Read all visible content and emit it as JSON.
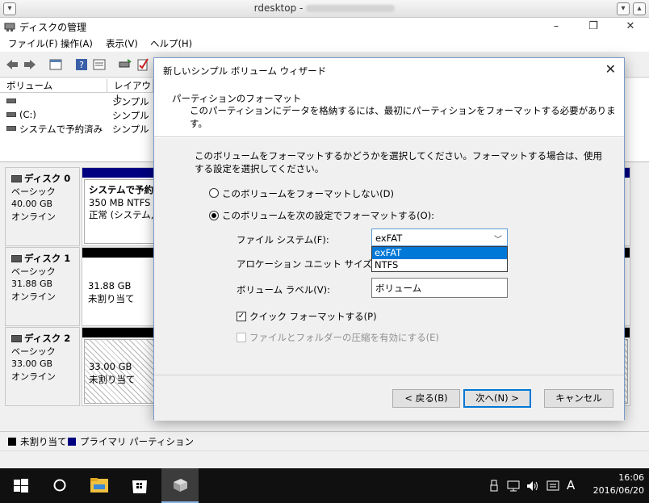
{
  "window": {
    "title": "rdesktop -",
    "app_title": "ディスクの管理",
    "minimize": "–",
    "restore": "❐",
    "close": "✕"
  },
  "menu": [
    "ファイル(F)",
    "操作(A)",
    "表示(V)",
    "ヘルプ(H)"
  ],
  "volume_list": {
    "columns": [
      "ボリューム",
      "レイアウト"
    ],
    "rows": [
      {
        "name": "",
        "layout": "シンプル"
      },
      {
        "name": "(C:)",
        "layout": "シンプル"
      },
      {
        "name": "システムで予約済み",
        "layout": "シンプル"
      }
    ]
  },
  "disks": [
    {
      "name": "ディスク 0",
      "type": "ベーシック",
      "size": "40.00 GB",
      "status": "オンライン",
      "partition": {
        "line1": "システムで予約済",
        "line2": "350 MB NTFS",
        "line3": "正常 (システム, ア"
      }
    },
    {
      "name": "ディスク 1",
      "type": "ベーシック",
      "size": "31.88 GB",
      "status": "オンライン",
      "partition": {
        "line1": "31.88 GB",
        "line2": "未割り当て"
      }
    },
    {
      "name": "ディスク 2",
      "type": "ベーシック",
      "size": "33.00 GB",
      "status": "オンライン",
      "partition": {
        "line1": "33.00 GB",
        "line2": "未割り当て"
      }
    }
  ],
  "legend": {
    "unallocated": "未割り当て",
    "primary": "プライマリ パーティション",
    "colors": {
      "unallocated": "#000000",
      "primary": "#000080"
    }
  },
  "dialog": {
    "title": "新しいシンプル ボリューム ウィザード",
    "close": "✕",
    "header_title": "パーティションのフォーマット",
    "header_subtitle": "このパーティションにデータを格納するには、最初にパーティションをフォーマットする必要があります。",
    "intro": "このボリュームをフォーマットするかどうかを選択してください。フォーマットする場合は、使用する設定を選択してください。",
    "radio_no_format": "このボリュームをフォーマットしない(D)",
    "radio_format": "このボリュームを次の設定でフォーマットする(O):",
    "fs_label": "ファイル システム(F):",
    "fs_value": "exFAT",
    "fs_options": [
      "exFAT",
      "NTFS"
    ],
    "alloc_label": "アロケーション ユニット サイズ(A):",
    "vol_label_label": "ボリューム ラベル(V):",
    "vol_label_value": "ボリューム",
    "quick_format": "クイック フォーマットする(P)",
    "compression": "ファイルとフォルダーの圧縮を有効にする(E)",
    "back": "< 戻る(B)",
    "next": "次へ(N) >",
    "cancel": "キャンセル"
  },
  "taskbar": {
    "ime": "A",
    "time": "16:06",
    "date": "2016/06/20"
  }
}
